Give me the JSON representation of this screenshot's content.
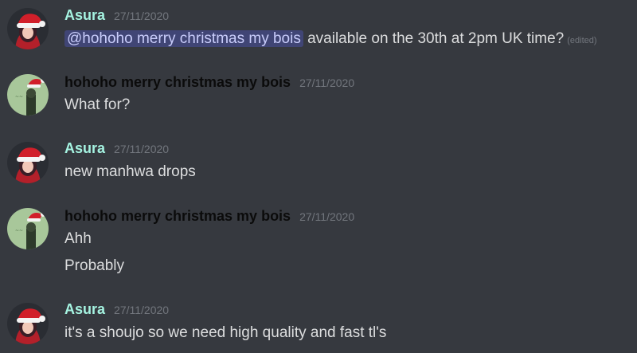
{
  "colors": {
    "background": "#36393f",
    "asura_name": "#a5f3e1",
    "hohoho_name": "#0b0b0b",
    "message_text": "#dcddde",
    "timestamp": "#72767d",
    "mention_bg": "#5865f2"
  },
  "messages": [
    {
      "author": "Asura",
      "timestamp": "27/11/2020",
      "avatar": "santa-hat-girl-avatar",
      "lines": [
        {
          "mention": "@hohoho merry christmas my bois",
          "text": " available on the 30th at 2pm UK time?",
          "edited": "(edited)"
        }
      ]
    },
    {
      "author": "hohoho merry christmas my bois",
      "timestamp": "27/11/2020",
      "avatar": "santa-hat-green-avatar",
      "lines": [
        {
          "text": "What for?"
        }
      ]
    },
    {
      "author": "Asura",
      "timestamp": "27/11/2020",
      "avatar": "santa-hat-girl-avatar",
      "lines": [
        {
          "text": "new manhwa drops"
        }
      ]
    },
    {
      "author": "hohoho merry christmas my bois",
      "timestamp": "27/11/2020",
      "avatar": "santa-hat-green-avatar",
      "lines": [
        {
          "text": "Ahh"
        },
        {
          "text": "Probably"
        }
      ]
    },
    {
      "author": "Asura",
      "timestamp": "27/11/2020",
      "avatar": "santa-hat-girl-avatar",
      "lines": [
        {
          "text": "it's a shoujo so we need high quality and fast tl's"
        }
      ]
    }
  ]
}
